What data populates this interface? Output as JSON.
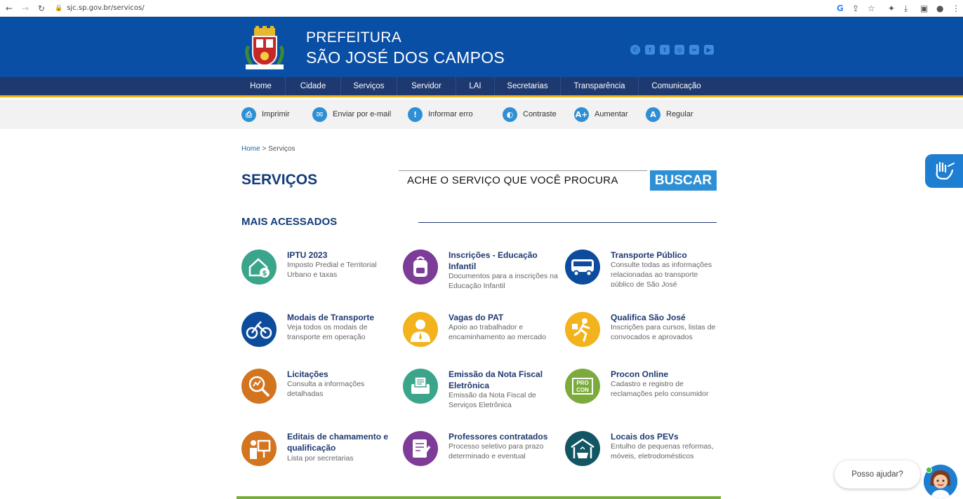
{
  "browser": {
    "url": "sjc.sp.gov.br/servicos/",
    "back_icon": "arrow-left-icon",
    "forward_icon": "arrow-right-icon",
    "reload_icon": "reload-icon"
  },
  "header": {
    "brand_line1": "PREFEITURA",
    "brand_line2": "SÃO JOSÉ DOS CAMPOS",
    "colors": {
      "header_bg": "#0a4fa6",
      "nav_bg": "#1d3970",
      "nav_accent": "#f4b219"
    },
    "socials": [
      "whatsapp-icon",
      "facebook-icon",
      "twitter-icon",
      "instagram-icon",
      "flickr-icon",
      "youtube-icon"
    ]
  },
  "nav": {
    "items": [
      "Home",
      "Cidade",
      "Serviços",
      "Servidor",
      "LAI",
      "Secretarias",
      "Transparência",
      "Comunicação"
    ]
  },
  "toolbar": {
    "items": [
      {
        "label": "Imprimir",
        "icon": "print-icon"
      },
      {
        "label": "Enviar por e-mail",
        "icon": "email-icon"
      },
      {
        "label": "Informar erro",
        "icon": "report-error-icon"
      },
      {
        "label": "Contraste",
        "icon": "contrast-icon"
      },
      {
        "label": "Aumentar",
        "icon": "font-increase-icon"
      },
      {
        "label": "Regular",
        "icon": "font-regular-icon"
      }
    ]
  },
  "breadcrumb": {
    "home": "Home",
    "separator": ">",
    "current": "Serviços"
  },
  "page": {
    "title": "SERVIÇOS",
    "search_placeholder": "ACHE O SERVIÇO QUE VOCÊ PROCURA",
    "search_button": "BUSCAR"
  },
  "section": {
    "title": "MAIS ACESSADOS"
  },
  "services": [
    {
      "title": "IPTU 2023",
      "desc": "Imposto Predial e Territorial Urbano e taxas",
      "icon": "house-money-icon",
      "color": "#3aa58b"
    },
    {
      "title": "Inscrições - Educação Infantil",
      "desc": "Documentos para a inscrições na Educação Infantil",
      "icon": "backpack-icon",
      "color": "#7c3c97"
    },
    {
      "title": "Transporte Público",
      "desc": "Consulte todas as informações relacionadas ao transporte público de São José",
      "icon": "bus-icon",
      "color": "#0d4c9c"
    },
    {
      "title": "Modais de Transporte",
      "desc": "Veja todos os modais de transporte em operação",
      "icon": "bicycle-icon",
      "color": "#0d4c9c"
    },
    {
      "title": "Vagas do PAT",
      "desc": "Apoio ao trabalhador e encaminhamento ao mercado",
      "icon": "worker-icon",
      "color": "#f2b31c"
    },
    {
      "title": "Qualifica São José",
      "desc": "Inscrições para cursos, listas de convocados e aprovados",
      "icon": "runner-icon",
      "color": "#f2b31c"
    },
    {
      "title": "Licitações",
      "desc": "Consulta a informações detalhadas",
      "icon": "magnifier-icon",
      "color": "#d3741f"
    },
    {
      "title": "Emissão da Nota Fiscal Eletrônica",
      "desc": "Emissão da Nota Fiscal de Serviços Eletrônica",
      "icon": "receipt-icon",
      "color": "#3aa58b"
    },
    {
      "title": "Procon Online",
      "desc": "Cadastro e registro de reclamações pelo consumidor",
      "icon": "procon-icon",
      "color": "#7bab3c",
      "icon_text": "PRO CON"
    },
    {
      "title": "Editais de chamamento e qualificação",
      "desc": "Lista por secretarias",
      "icon": "presentation-icon",
      "color": "#d3741f"
    },
    {
      "title": "Professores contratados",
      "desc": "Processo seletivo para prazo determinado e eventual",
      "icon": "document-pen-icon",
      "color": "#7c3c97"
    },
    {
      "title": "Locais dos PEVs",
      "desc": "Entulho de pequenas reformas, móveis, eletrodomésticos",
      "icon": "recycle-station-icon",
      "color": "#125563"
    }
  ],
  "widgets": {
    "chat_text": "Posso ajudar?",
    "vlibras_icon": "sign-language-icon"
  }
}
